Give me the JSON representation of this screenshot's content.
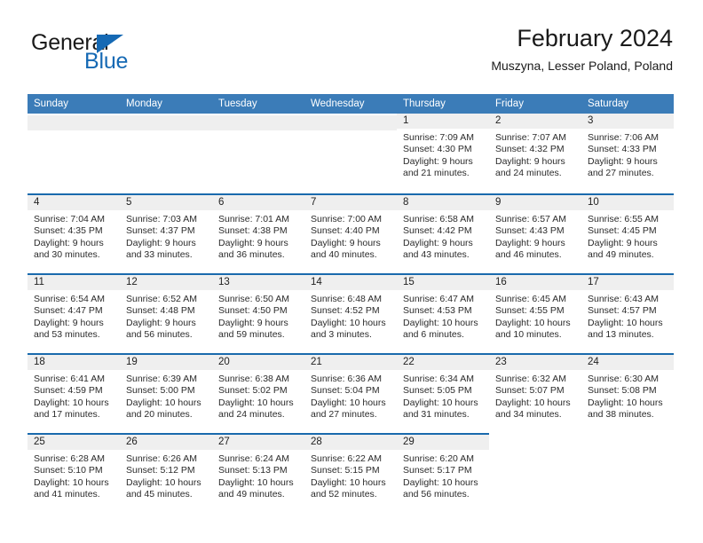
{
  "brand": {
    "word1": "General",
    "word2": "Blue",
    "triangle_color": "#1569b4",
    "text_color": "#1a1a1a"
  },
  "header": {
    "title": "February 2024",
    "subtitle": "Muszyna, Lesser Poland, Poland"
  },
  "theme": {
    "header_bg": "#3b7cb8",
    "header_text": "#ffffff",
    "row_rule": "#1a6aad",
    "daynum_band": "#efefef",
    "cell_bg": "#ffffff"
  },
  "calendar": {
    "weekdays": [
      "Sunday",
      "Monday",
      "Tuesday",
      "Wednesday",
      "Thursday",
      "Friday",
      "Saturday"
    ],
    "weeks": [
      [
        {
          "day": "",
          "lines": []
        },
        {
          "day": "",
          "lines": []
        },
        {
          "day": "",
          "lines": []
        },
        {
          "day": "",
          "lines": []
        },
        {
          "day": "1",
          "lines": [
            "Sunrise: 7:09 AM",
            "Sunset: 4:30 PM",
            "Daylight: 9 hours",
            "and 21 minutes."
          ]
        },
        {
          "day": "2",
          "lines": [
            "Sunrise: 7:07 AM",
            "Sunset: 4:32 PM",
            "Daylight: 9 hours",
            "and 24 minutes."
          ]
        },
        {
          "day": "3",
          "lines": [
            "Sunrise: 7:06 AM",
            "Sunset: 4:33 PM",
            "Daylight: 9 hours",
            "and 27 minutes."
          ]
        }
      ],
      [
        {
          "day": "4",
          "lines": [
            "Sunrise: 7:04 AM",
            "Sunset: 4:35 PM",
            "Daylight: 9 hours",
            "and 30 minutes."
          ]
        },
        {
          "day": "5",
          "lines": [
            "Sunrise: 7:03 AM",
            "Sunset: 4:37 PM",
            "Daylight: 9 hours",
            "and 33 minutes."
          ]
        },
        {
          "day": "6",
          "lines": [
            "Sunrise: 7:01 AM",
            "Sunset: 4:38 PM",
            "Daylight: 9 hours",
            "and 36 minutes."
          ]
        },
        {
          "day": "7",
          "lines": [
            "Sunrise: 7:00 AM",
            "Sunset: 4:40 PM",
            "Daylight: 9 hours",
            "and 40 minutes."
          ]
        },
        {
          "day": "8",
          "lines": [
            "Sunrise: 6:58 AM",
            "Sunset: 4:42 PM",
            "Daylight: 9 hours",
            "and 43 minutes."
          ]
        },
        {
          "day": "9",
          "lines": [
            "Sunrise: 6:57 AM",
            "Sunset: 4:43 PM",
            "Daylight: 9 hours",
            "and 46 minutes."
          ]
        },
        {
          "day": "10",
          "lines": [
            "Sunrise: 6:55 AM",
            "Sunset: 4:45 PM",
            "Daylight: 9 hours",
            "and 49 minutes."
          ]
        }
      ],
      [
        {
          "day": "11",
          "lines": [
            "Sunrise: 6:54 AM",
            "Sunset: 4:47 PM",
            "Daylight: 9 hours",
            "and 53 minutes."
          ]
        },
        {
          "day": "12",
          "lines": [
            "Sunrise: 6:52 AM",
            "Sunset: 4:48 PM",
            "Daylight: 9 hours",
            "and 56 minutes."
          ]
        },
        {
          "day": "13",
          "lines": [
            "Sunrise: 6:50 AM",
            "Sunset: 4:50 PM",
            "Daylight: 9 hours",
            "and 59 minutes."
          ]
        },
        {
          "day": "14",
          "lines": [
            "Sunrise: 6:48 AM",
            "Sunset: 4:52 PM",
            "Daylight: 10 hours",
            "and 3 minutes."
          ]
        },
        {
          "day": "15",
          "lines": [
            "Sunrise: 6:47 AM",
            "Sunset: 4:53 PM",
            "Daylight: 10 hours",
            "and 6 minutes."
          ]
        },
        {
          "day": "16",
          "lines": [
            "Sunrise: 6:45 AM",
            "Sunset: 4:55 PM",
            "Daylight: 10 hours",
            "and 10 minutes."
          ]
        },
        {
          "day": "17",
          "lines": [
            "Sunrise: 6:43 AM",
            "Sunset: 4:57 PM",
            "Daylight: 10 hours",
            "and 13 minutes."
          ]
        }
      ],
      [
        {
          "day": "18",
          "lines": [
            "Sunrise: 6:41 AM",
            "Sunset: 4:59 PM",
            "Daylight: 10 hours",
            "and 17 minutes."
          ]
        },
        {
          "day": "19",
          "lines": [
            "Sunrise: 6:39 AM",
            "Sunset: 5:00 PM",
            "Daylight: 10 hours",
            "and 20 minutes."
          ]
        },
        {
          "day": "20",
          "lines": [
            "Sunrise: 6:38 AM",
            "Sunset: 5:02 PM",
            "Daylight: 10 hours",
            "and 24 minutes."
          ]
        },
        {
          "day": "21",
          "lines": [
            "Sunrise: 6:36 AM",
            "Sunset: 5:04 PM",
            "Daylight: 10 hours",
            "and 27 minutes."
          ]
        },
        {
          "day": "22",
          "lines": [
            "Sunrise: 6:34 AM",
            "Sunset: 5:05 PM",
            "Daylight: 10 hours",
            "and 31 minutes."
          ]
        },
        {
          "day": "23",
          "lines": [
            "Sunrise: 6:32 AM",
            "Sunset: 5:07 PM",
            "Daylight: 10 hours",
            "and 34 minutes."
          ]
        },
        {
          "day": "24",
          "lines": [
            "Sunrise: 6:30 AM",
            "Sunset: 5:08 PM",
            "Daylight: 10 hours",
            "and 38 minutes."
          ]
        }
      ],
      [
        {
          "day": "25",
          "lines": [
            "Sunrise: 6:28 AM",
            "Sunset: 5:10 PM",
            "Daylight: 10 hours",
            "and 41 minutes."
          ]
        },
        {
          "day": "26",
          "lines": [
            "Sunrise: 6:26 AM",
            "Sunset: 5:12 PM",
            "Daylight: 10 hours",
            "and 45 minutes."
          ]
        },
        {
          "day": "27",
          "lines": [
            "Sunrise: 6:24 AM",
            "Sunset: 5:13 PM",
            "Daylight: 10 hours",
            "and 49 minutes."
          ]
        },
        {
          "day": "28",
          "lines": [
            "Sunrise: 6:22 AM",
            "Sunset: 5:15 PM",
            "Daylight: 10 hours",
            "and 52 minutes."
          ]
        },
        {
          "day": "29",
          "lines": [
            "Sunrise: 6:20 AM",
            "Sunset: 5:17 PM",
            "Daylight: 10 hours",
            "and 56 minutes."
          ]
        },
        {
          "day": "",
          "lines": []
        },
        {
          "day": "",
          "lines": []
        }
      ]
    ]
  }
}
